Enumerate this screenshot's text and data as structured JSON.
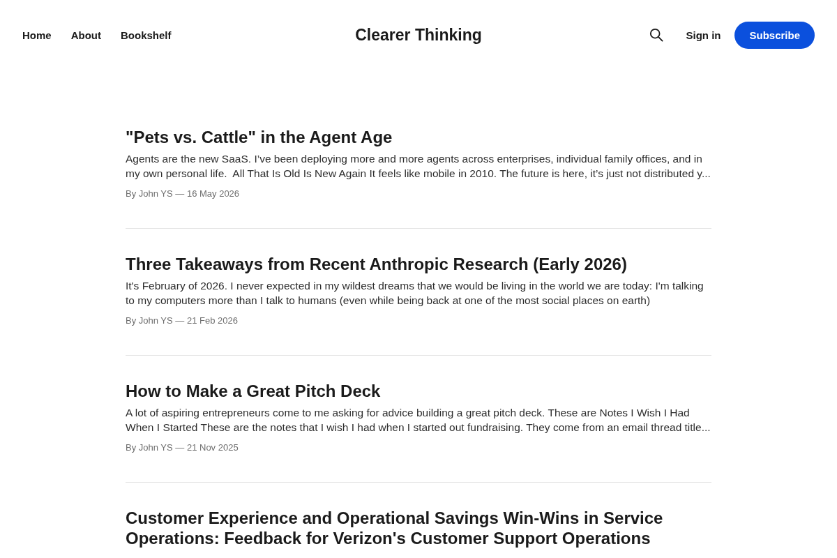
{
  "nav": {
    "links": [
      "Home",
      "About",
      "Bookshelf"
    ],
    "site_title": "Clearer Thinking",
    "sign_in": "Sign in",
    "subscribe": "Subscribe"
  },
  "posts": [
    {
      "title": "\"Pets vs. Cattle\" in the Agent Age",
      "excerpt": "Agents are the new SaaS. I’ve been deploying more and more agents across enterprises, individual family offices, and in my own personal life.  All That Is Old Is New Again It feels like mobile in 2010. The future is here, it’s just not distributed y...",
      "meta": "By John YS — 16 May 2026"
    },
    {
      "title": "Three Takeaways from Recent Anthropic Research (Early 2026)",
      "excerpt": "It's February of 2026. I never expected in my wildest dreams that we would be living in the world we are today: I'm talking to my computers more than I talk to humans (even while being back at one of the most social places on earth)",
      "meta": "By John YS — 21 Feb 2026"
    },
    {
      "title": "How to Make a Great Pitch Deck",
      "excerpt": "A lot of aspiring entrepreneurs come to me asking for advice building a great pitch deck. These are Notes I Wish I Had When I Started These are the notes that I wish I had when I started out fundraising. They come from an email thread title...",
      "meta": "By John YS — 21 Nov 2025"
    },
    {
      "title": "Customer Experience and Operational Savings Win-Wins in Service Operations: Feedback for Verizon's Customer Support Operations"
    }
  ]
}
